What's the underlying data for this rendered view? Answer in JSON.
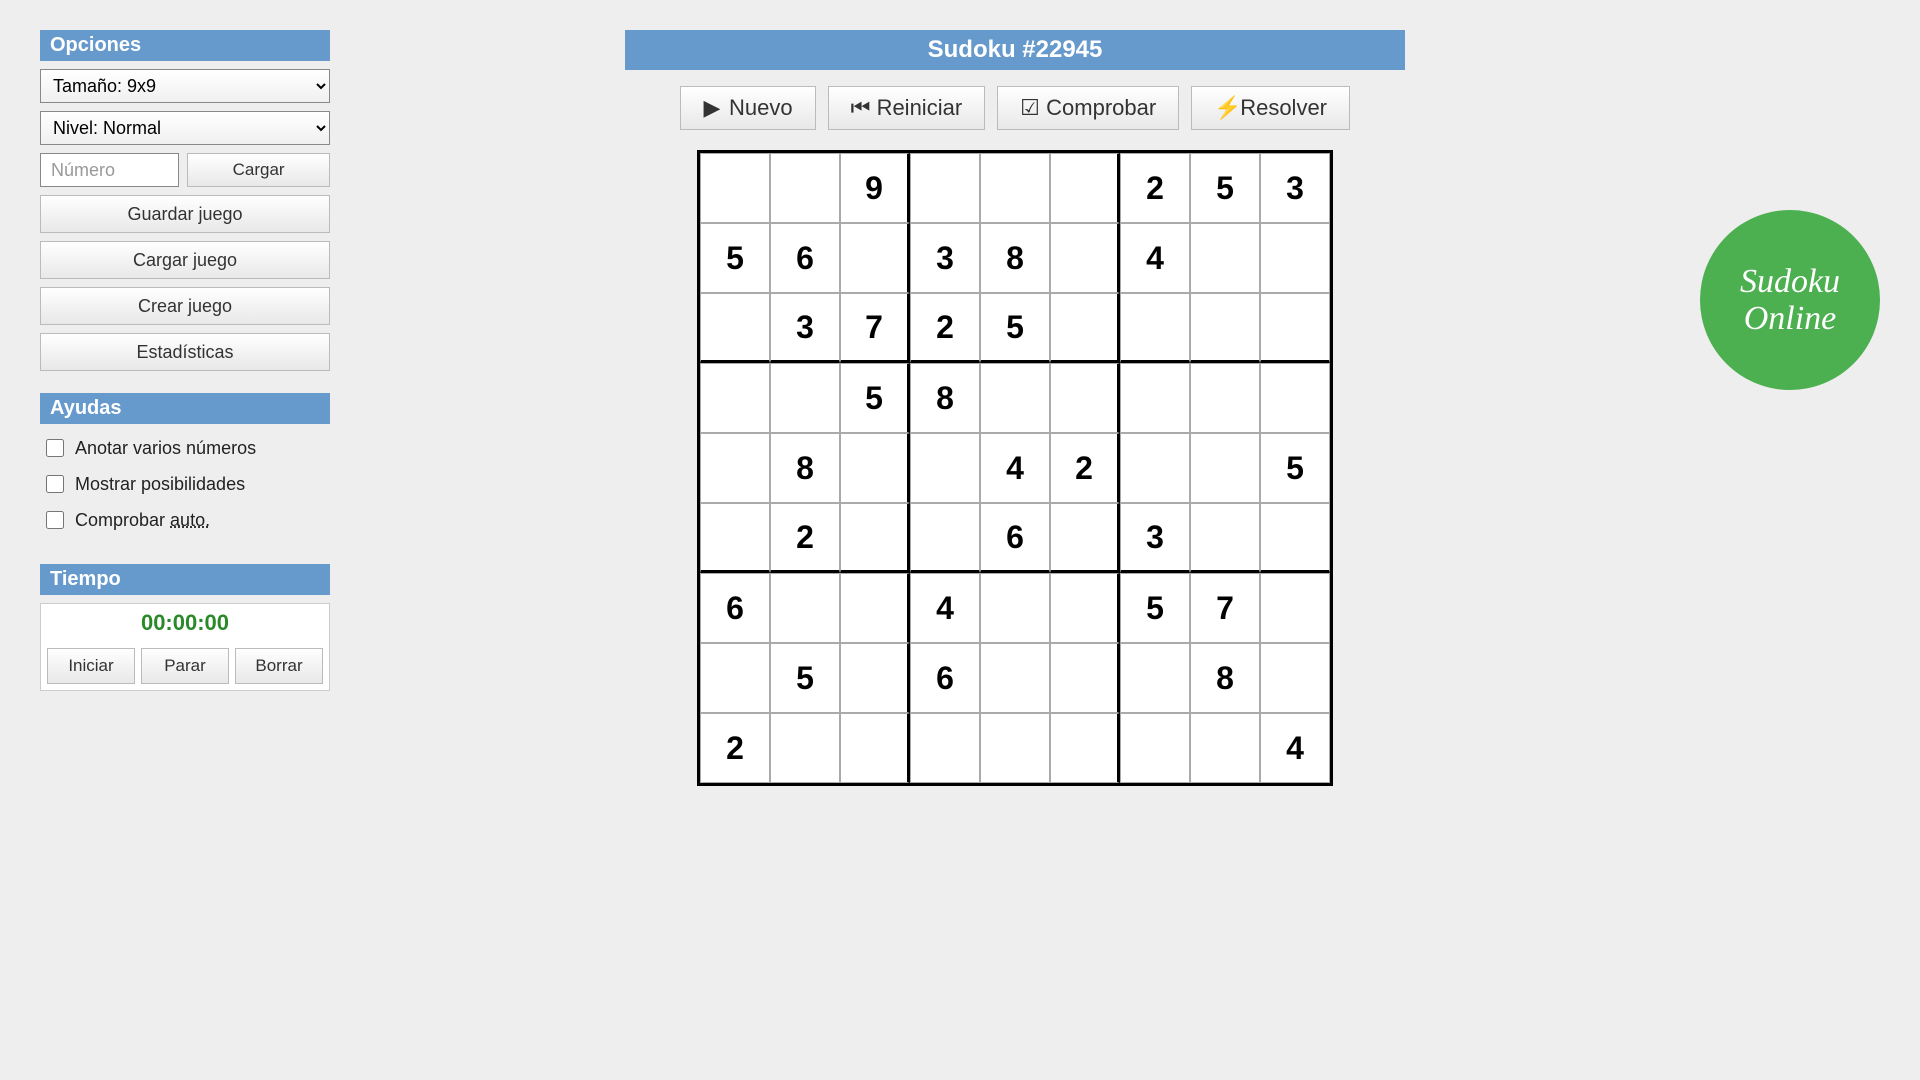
{
  "title": "Sudoku #22945",
  "toolbar": {
    "new": "Nuevo",
    "restart": "Reiniciar",
    "check": "Comprobar",
    "solve": "Resolver"
  },
  "options": {
    "header": "Opciones",
    "size": "Tamaño: 9x9",
    "level": "Nivel: Normal",
    "number_placeholder": "Número",
    "load": "Cargar",
    "save_game": "Guardar juego",
    "load_game": "Cargar juego",
    "create_game": "Crear juego",
    "stats": "Estadísticas"
  },
  "helps": {
    "header": "Ayudas",
    "annotate": "Anotar varios números",
    "show_poss": "Mostrar posibilidades",
    "auto_check_pre": "Comprobar ",
    "auto_check_dotted": "auto."
  },
  "time": {
    "header": "Tiempo",
    "value": "00:00:00",
    "start": "Iniciar",
    "stop": "Parar",
    "clear": "Borrar"
  },
  "logo": {
    "line1": "Sudoku",
    "line2": "Online"
  },
  "grid": [
    [
      "",
      "",
      "9",
      "",
      "",
      "",
      "2",
      "5",
      "3"
    ],
    [
      "5",
      "6",
      "",
      "3",
      "8",
      "",
      "4",
      "",
      ""
    ],
    [
      "",
      "3",
      "7",
      "2",
      "5",
      "",
      "",
      "",
      ""
    ],
    [
      "",
      "",
      "5",
      "8",
      "",
      "",
      "",
      "",
      ""
    ],
    [
      "",
      "8",
      "",
      "",
      "4",
      "2",
      "",
      "",
      "5"
    ],
    [
      "",
      "2",
      "",
      "",
      "6",
      "",
      "3",
      "",
      ""
    ],
    [
      "6",
      "",
      "",
      "4",
      "",
      "",
      "5",
      "7",
      ""
    ],
    [
      "",
      "5",
      "",
      "6",
      "",
      "",
      "",
      "8",
      ""
    ],
    [
      "2",
      "",
      "",
      "",
      "",
      "",
      "",
      "",
      "4"
    ]
  ]
}
